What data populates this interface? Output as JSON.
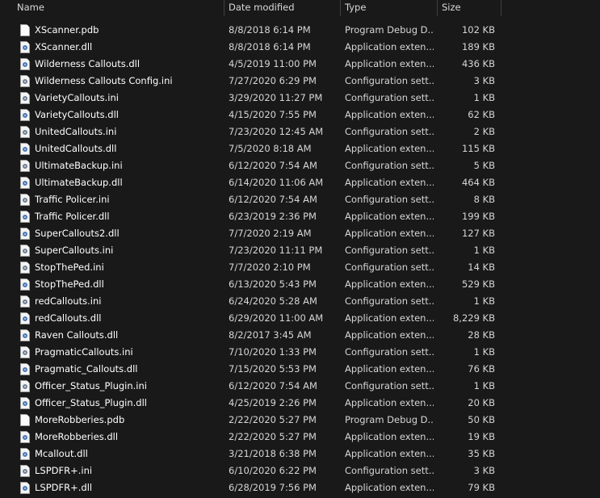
{
  "columns": {
    "name": "Name",
    "date": "Date modified",
    "type": "Type",
    "size": "Size"
  },
  "files": [
    {
      "name": "XScanner.pdb",
      "date": "8/8/2018 6:14 PM",
      "type": "Program Debug D...",
      "size": "102 KB",
      "icon": "pdb"
    },
    {
      "name": "XScanner.dll",
      "date": "8/8/2018 6:14 PM",
      "type": "Application exten...",
      "size": "189 KB",
      "icon": "dll"
    },
    {
      "name": "Wilderness Callouts.dll",
      "date": "4/5/2019 11:00 PM",
      "type": "Application exten...",
      "size": "436 KB",
      "icon": "dll"
    },
    {
      "name": "Wilderness Callouts Config.ini",
      "date": "7/27/2020 6:29 PM",
      "type": "Configuration sett...",
      "size": "3 KB",
      "icon": "ini"
    },
    {
      "name": "VarietyCallouts.ini",
      "date": "3/29/2020 11:27 PM",
      "type": "Configuration sett...",
      "size": "1 KB",
      "icon": "ini"
    },
    {
      "name": "VarietyCallouts.dll",
      "date": "4/15/2020 7:55 PM",
      "type": "Application exten...",
      "size": "62 KB",
      "icon": "dll"
    },
    {
      "name": "UnitedCallouts.ini",
      "date": "7/23/2020 12:45 AM",
      "type": "Configuration sett...",
      "size": "2 KB",
      "icon": "ini"
    },
    {
      "name": "UnitedCallouts.dll",
      "date": "7/5/2020 8:18 AM",
      "type": "Application exten...",
      "size": "115 KB",
      "icon": "dll"
    },
    {
      "name": "UltimateBackup.ini",
      "date": "6/12/2020 7:54 AM",
      "type": "Configuration sett...",
      "size": "5 KB",
      "icon": "ini"
    },
    {
      "name": "UltimateBackup.dll",
      "date": "6/14/2020 11:06 AM",
      "type": "Application exten...",
      "size": "464 KB",
      "icon": "dll"
    },
    {
      "name": "Traffic Policer.ini",
      "date": "6/12/2020 7:54 AM",
      "type": "Configuration sett...",
      "size": "8 KB",
      "icon": "ini"
    },
    {
      "name": "Traffic Policer.dll",
      "date": "6/23/2019 2:36 PM",
      "type": "Application exten...",
      "size": "199 KB",
      "icon": "dll"
    },
    {
      "name": "SuperCallouts2.dll",
      "date": "7/7/2020 2:19 AM",
      "type": "Application exten...",
      "size": "127 KB",
      "icon": "dll"
    },
    {
      "name": "SuperCallouts.ini",
      "date": "7/23/2020 11:11 PM",
      "type": "Configuration sett...",
      "size": "1 KB",
      "icon": "ini"
    },
    {
      "name": "StopThePed.ini",
      "date": "7/7/2020 2:10 PM",
      "type": "Configuration sett...",
      "size": "14 KB",
      "icon": "ini"
    },
    {
      "name": "StopThePed.dll",
      "date": "6/13/2020 5:43 PM",
      "type": "Application exten...",
      "size": "529 KB",
      "icon": "dll"
    },
    {
      "name": "redCallouts.ini",
      "date": "6/24/2020 5:28 AM",
      "type": "Configuration sett...",
      "size": "1 KB",
      "icon": "ini"
    },
    {
      "name": "redCallouts.dll",
      "date": "6/29/2020 11:00 AM",
      "type": "Application exten...",
      "size": "8,229 KB",
      "icon": "dll"
    },
    {
      "name": "Raven Callouts.dll",
      "date": "8/2/2017 3:45 AM",
      "type": "Application exten...",
      "size": "28 KB",
      "icon": "dll"
    },
    {
      "name": "PragmaticCallouts.ini",
      "date": "7/10/2020 1:33 PM",
      "type": "Configuration sett...",
      "size": "1 KB",
      "icon": "ini"
    },
    {
      "name": "Pragmatic_Callouts.dll",
      "date": "7/15/2020 5:53 PM",
      "type": "Application exten...",
      "size": "76 KB",
      "icon": "dll"
    },
    {
      "name": "Officer_Status_Plugin.ini",
      "date": "6/12/2020 7:54 AM",
      "type": "Configuration sett...",
      "size": "1 KB",
      "icon": "ini"
    },
    {
      "name": "Officer_Status_Plugin.dll",
      "date": "4/25/2019 2:26 PM",
      "type": "Application exten...",
      "size": "20 KB",
      "icon": "dll"
    },
    {
      "name": "MoreRobberies.pdb",
      "date": "2/22/2020 5:27 PM",
      "type": "Program Debug D...",
      "size": "50 KB",
      "icon": "pdb"
    },
    {
      "name": "MoreRobberies.dll",
      "date": "2/22/2020 5:27 PM",
      "type": "Application exten...",
      "size": "19 KB",
      "icon": "dll"
    },
    {
      "name": "Mcallout.dll",
      "date": "3/21/2018 6:38 PM",
      "type": "Application exten...",
      "size": "35 KB",
      "icon": "dll"
    },
    {
      "name": "LSPDFR+.ini",
      "date": "6/10/2020 6:22 PM",
      "type": "Configuration sett...",
      "size": "3 KB",
      "icon": "ini"
    },
    {
      "name": "LSPDFR+.dll",
      "date": "6/28/2019 7:56 PM",
      "type": "Application exten...",
      "size": "79 KB",
      "icon": "dll"
    }
  ]
}
